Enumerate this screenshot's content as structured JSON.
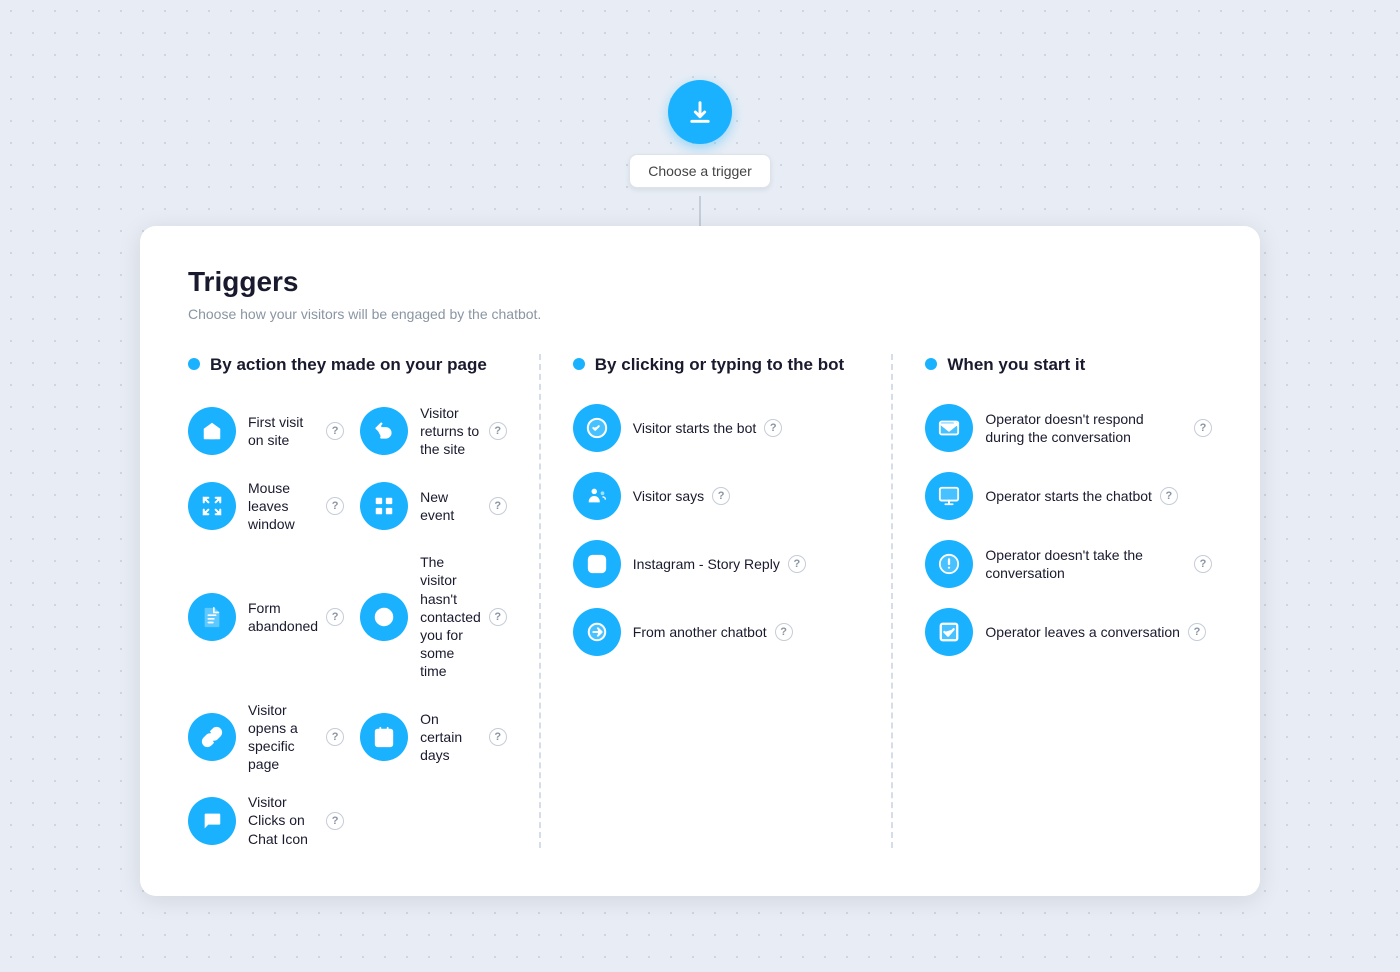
{
  "trigger_button": {
    "label": "Choose a trigger",
    "arrow_icon": "arrow-down-icon"
  },
  "card": {
    "title": "Triggers",
    "subtitle": "Choose how your visitors will be engaged by the chatbot."
  },
  "columns": [
    {
      "id": "by-action",
      "title": "By action they made on your page",
      "items_left": [
        {
          "id": "first-visit",
          "label": "First visit on site"
        },
        {
          "id": "mouse-leaves",
          "label": "Mouse leaves window"
        },
        {
          "id": "form-abandoned",
          "label": "Form abandoned"
        },
        {
          "id": "visitor-opens",
          "label": "Visitor opens a specific page"
        },
        {
          "id": "visitor-clicks",
          "label": "Visitor Clicks on Chat Icon"
        }
      ],
      "items_right": [
        {
          "id": "visitor-returns",
          "label": "Visitor returns to the site"
        },
        {
          "id": "new-event",
          "label": "New event"
        },
        {
          "id": "not-contacted",
          "label": "The visitor hasn't contacted you for some time"
        },
        {
          "id": "certain-days",
          "label": "On certain days"
        }
      ]
    },
    {
      "id": "by-clicking",
      "title": "By clicking or typing to the bot",
      "items": [
        {
          "id": "visitor-starts-bot",
          "label": "Visitor starts the bot"
        },
        {
          "id": "visitor-says",
          "label": "Visitor says"
        },
        {
          "id": "instagram-story",
          "label": "Instagram - Story Reply"
        },
        {
          "id": "from-another-chatbot",
          "label": "From another chatbot"
        }
      ]
    },
    {
      "id": "when-you-start",
      "title": "When you start it",
      "items": [
        {
          "id": "operator-no-respond",
          "label": "Operator doesn't respond during the conversation"
        },
        {
          "id": "operator-starts-chatbot",
          "label": "Operator starts the chatbot"
        },
        {
          "id": "operator-no-take",
          "label": "Operator doesn't take the conversation"
        },
        {
          "id": "operator-leaves",
          "label": "Operator leaves a conversation"
        }
      ]
    }
  ]
}
